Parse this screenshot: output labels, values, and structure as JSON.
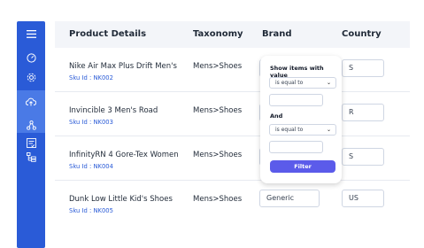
{
  "sidebar": {
    "icons": [
      "menu-icon",
      "gauge-icon",
      "settings-gear-icon",
      "upload-cloud-icon",
      "network-icon",
      "checklist-icon",
      "folder-tree-icon"
    ],
    "accent": "#2a5bd7"
  },
  "table": {
    "headers": [
      "Product Details",
      "Taxonomy",
      "Brand",
      "Country"
    ],
    "rows": [
      {
        "name": "Nike Air Max Plus Drift Men's",
        "sku": "Sku Id : NK002",
        "taxonomy": "Mens>Shoes",
        "brand": "",
        "country": "S"
      },
      {
        "name": "Invincible 3 Men's Road",
        "sku": "Sku Id : NK003",
        "taxonomy": "Mens>Shoes",
        "brand": "",
        "country": "R"
      },
      {
        "name": "InfinityRN 4 Gore-Tex Women",
        "sku": "Sku Id : NK004",
        "taxonomy": "Mens>Shoes",
        "brand": "",
        "country": "S"
      },
      {
        "name": "Dunk Low Little Kid's Shoes",
        "sku": "Sku Id : NK005",
        "taxonomy": "Mens>Shoes",
        "brand": "Generic",
        "country": "US"
      }
    ]
  },
  "filter_popup": {
    "title": "Show items with value",
    "select1": "is equal to",
    "connector": "And",
    "select2": "is equal to",
    "button": "Filter",
    "button_color": "#5b5bea"
  }
}
